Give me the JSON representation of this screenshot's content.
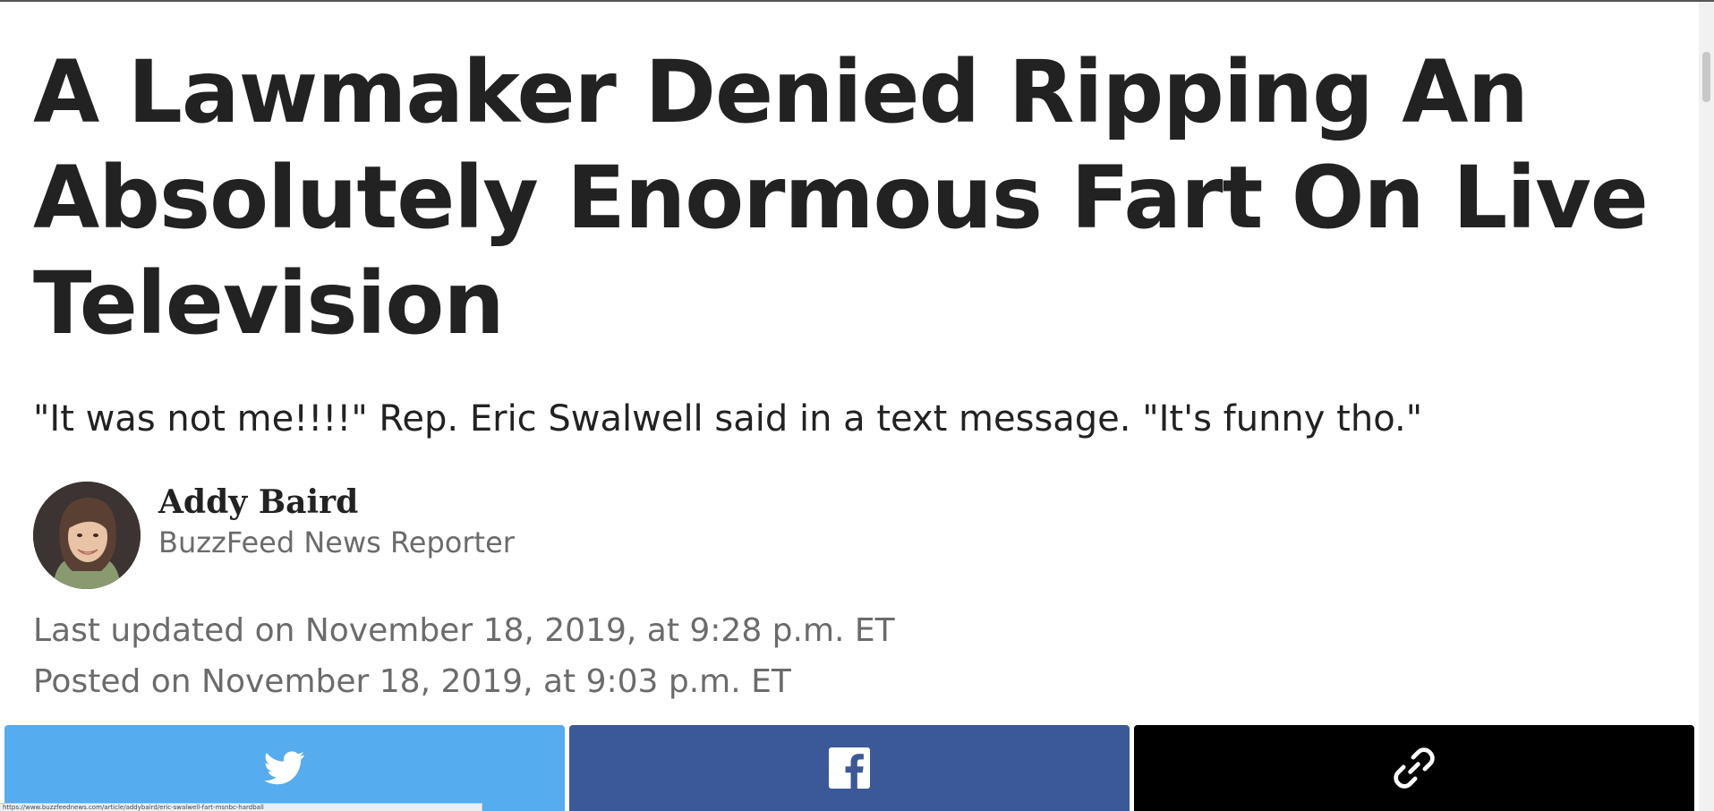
{
  "article": {
    "headline": "A Lawmaker Denied Ripping An Absolutely Enormous Fart On Live Television",
    "dek": "\"It was not me!!!!\" Rep. Eric Swalwell said in a text message. \"It's funny tho.\"",
    "byline": {
      "name": "Addy Baird",
      "role": "BuzzFeed News Reporter"
    },
    "updated": "Last updated on November 18, 2019, at 9:28 p.m. ET",
    "posted": "Posted on November 18, 2019, at 9:03 p.m. ET"
  },
  "share": {
    "twitter": {
      "icon": "twitter-icon",
      "color": "#55acee"
    },
    "facebook": {
      "icon": "facebook-icon",
      "color": "#3b5998"
    },
    "link": {
      "icon": "link-icon",
      "color": "#000000"
    }
  },
  "status_bar": {
    "url": "https://www.buzzfeednews.com/article/addybaird/eric-swalwell-fart-msnbc-hardball"
  }
}
